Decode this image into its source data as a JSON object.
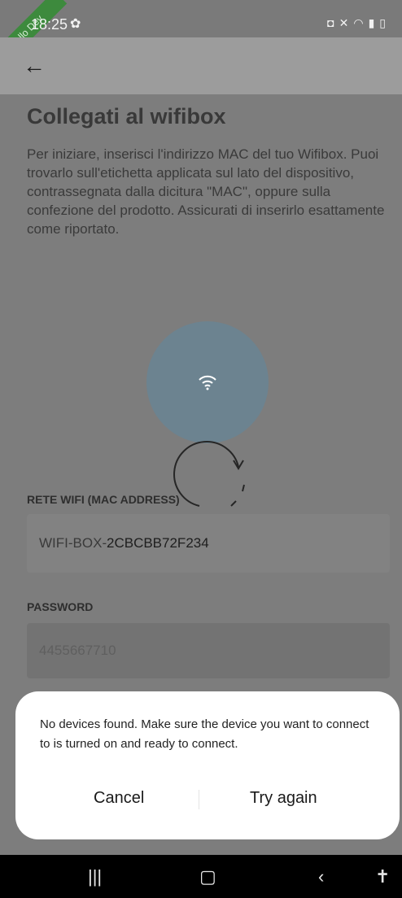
{
  "status_bar": {
    "time": "18:25",
    "ribbon": "Hello Dev"
  },
  "page": {
    "title": "Collegati al wifibox",
    "intro": "Per iniziare, inserisci l'indirizzo MAC del tuo Wifibox. Puoi trovarlo sull'etichetta applicata sul lato del dispositivo, contrassegnata dalla dicitura \"MAC\", oppure sulla confezione del prodotto. Assicurati di inserirlo esattamente come riportato."
  },
  "mac_field": {
    "label": "RETE WIFI (MAC ADDRESS)",
    "prefix": "WIFI-BOX-",
    "value": "2CBCBB72F234"
  },
  "password_field": {
    "label": "PASSWORD",
    "value": "4455667710"
  },
  "dialog": {
    "message": "No devices found. Make sure the device you want to connect to is turned on and ready to connect.",
    "cancel": "Cancel",
    "try_again": "Try again"
  },
  "icons": [
    "gear-icon",
    "battery-icon",
    "mute-icon",
    "wifi-icon",
    "signal-icon",
    "back-arrow-icon",
    "spinner-icon",
    "recents-icon",
    "home-icon",
    "back-icon",
    "accessibility-icon"
  ],
  "colors": {
    "overlay": "#7d7d7d",
    "dialog": "#ffffff",
    "wifi_circle": "#6c8390"
  }
}
